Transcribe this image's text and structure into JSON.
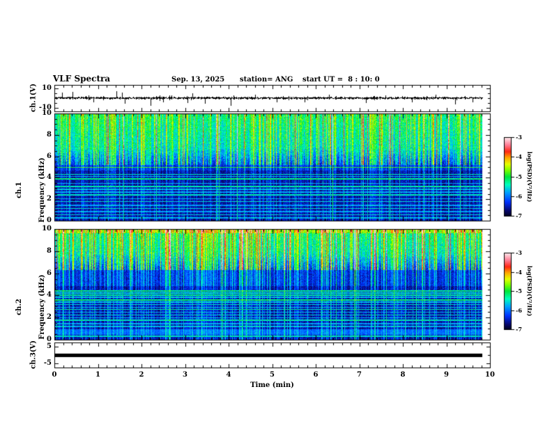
{
  "title": {
    "main": "VLF Spectra",
    "date": "Sep. 13, 2025",
    "station": "station= ANG",
    "start_ut": "start UT =  8 : 10: 0"
  },
  "x_axis": {
    "label": "Time (min)",
    "ticks": [
      0,
      1,
      2,
      3,
      4,
      5,
      6,
      7,
      8,
      9,
      10
    ],
    "range_min": [
      0,
      10
    ],
    "minor_step_min": 0.2,
    "data_end_min": 9.83
  },
  "colorbar": {
    "label": "log(PSD)(V²/Hz)",
    "ticks": [
      -3,
      -4,
      -5,
      -6,
      -7
    ],
    "range": [
      -7,
      -3
    ],
    "colormap_stops": [
      [
        0.0,
        "#02021e"
      ],
      [
        0.07,
        "#08086e"
      ],
      [
        0.18,
        "#0032ff"
      ],
      [
        0.3,
        "#00a0ff"
      ],
      [
        0.4,
        "#00ffbe"
      ],
      [
        0.5,
        "#00e63c"
      ],
      [
        0.58,
        "#78ff00"
      ],
      [
        0.66,
        "#e6ff00"
      ],
      [
        0.74,
        "#ffaa00"
      ],
      [
        0.82,
        "#ff2814"
      ],
      [
        0.9,
        "#ff7890"
      ],
      [
        1.0,
        "#ffebee"
      ]
    ]
  },
  "chart_data": {
    "type": "multi-panel spectrogram + waveforms",
    "panels": [
      {
        "id": "ch1-waveform",
        "type": "line",
        "ylabel": "ch.1(V)",
        "ytick_values": [
          10,
          -10
        ],
        "ylim": [
          -13,
          13
        ],
        "mean_v": 0,
        "noise_halfwidth_v": 0.8,
        "spikes": [
          {
            "t": 0.18,
            "a": 5.5
          },
          {
            "t": 0.42,
            "a": 6.5
          },
          {
            "t": 0.9,
            "a": -4.5
          },
          {
            "t": 1.42,
            "a": 7
          },
          {
            "t": 1.55,
            "a": 5.5
          },
          {
            "t": 1.62,
            "a": -6
          },
          {
            "t": 2.2,
            "a": -8
          },
          {
            "t": 2.5,
            "a": -4
          },
          {
            "t": 3.05,
            "a": -5
          },
          {
            "t": 3.16,
            "a": 5
          },
          {
            "t": 3.45,
            "a": -5.5
          },
          {
            "t": 4.05,
            "a": -7.5
          },
          {
            "t": 4.6,
            "a": 3.5
          },
          {
            "t": 5.1,
            "a": -4
          },
          {
            "t": 5.75,
            "a": -4.5
          },
          {
            "t": 6.3,
            "a": 3.5
          },
          {
            "t": 7.15,
            "a": -5
          },
          {
            "t": 7.6,
            "a": 3
          },
          {
            "t": 8.2,
            "a": -4
          },
          {
            "t": 8.75,
            "a": 3.5
          },
          {
            "t": 9.2,
            "a": -6.5
          },
          {
            "t": 9.6,
            "a": -4
          }
        ]
      },
      {
        "id": "ch1-spectrogram",
        "type": "heatmap",
        "ylabel_line1": "ch.1",
        "ylabel_line2": "Frequency (kHz)",
        "ylim": [
          0,
          10
        ],
        "yticks": [
          0,
          2,
          4,
          6,
          8,
          10
        ],
        "minor_step_khz": 0.5,
        "texture": {
          "seed": 1234567,
          "bright_band_khz": [
            5.2,
            10
          ],
          "mid_band_khz": [
            4.7,
            5.2
          ],
          "dark_band_khz": [
            0,
            4.7
          ],
          "streak_density": 0.55,
          "strong_streak_prob": 0.07,
          "lines_khz": [
            5.0,
            4.35,
            4.15,
            3.9,
            3.5,
            3.2,
            2.95,
            2.7,
            2.4,
            2.05,
            1.8,
            1.45,
            1.15,
            0.85,
            0.55,
            0.25
          ],
          "line_strengths": [
            0.5,
            0.38,
            0.3,
            0.42,
            0.3,
            0.38,
            0.3,
            0.28,
            0.36,
            0.3,
            0.34,
            0.28,
            0.34,
            0.28,
            0.34,
            0.3
          ]
        }
      },
      {
        "id": "ch2-spectrogram",
        "type": "heatmap",
        "ylabel_line1": "ch.2",
        "ylabel_line2": "Frequency (kHz)",
        "ylim": [
          0,
          10
        ],
        "yticks": [
          0,
          2,
          4,
          6,
          8,
          10
        ],
        "minor_step_khz": 0.5,
        "texture": {
          "seed": 7654321,
          "bright_band_khz": [
            6.3,
            10
          ],
          "mid_band_khz": [
            4.9,
            6.3
          ],
          "dark_band_khz": [
            0,
            4.9
          ],
          "hiss_band_khz": [
            0.45,
            0.95
          ],
          "bright_top_edge_khz": 9.7,
          "streak_density": 0.6,
          "strong_streak_prob": 0.13,
          "lines_khz": [
            4.45,
            4.25,
            4.05,
            3.85,
            3.6,
            3.4,
            3.2,
            2.95,
            2.75,
            2.5,
            2.25,
            2.0,
            1.75,
            1.45,
            1.2,
            0.3
          ],
          "line_strengths": [
            0.4,
            0.34,
            0.38,
            0.3,
            0.42,
            0.3,
            0.34,
            0.3,
            0.38,
            0.3,
            0.34,
            0.3,
            0.36,
            0.28,
            0.3,
            0.34
          ]
        }
      },
      {
        "id": "ch3-waveform",
        "type": "line",
        "ylabel": "ch.3(V)",
        "ytick_values": [
          5,
          -5
        ],
        "ylim": [
          -7.5,
          7.5
        ],
        "value_v": 0,
        "line_thickness_v": 2
      }
    ]
  }
}
